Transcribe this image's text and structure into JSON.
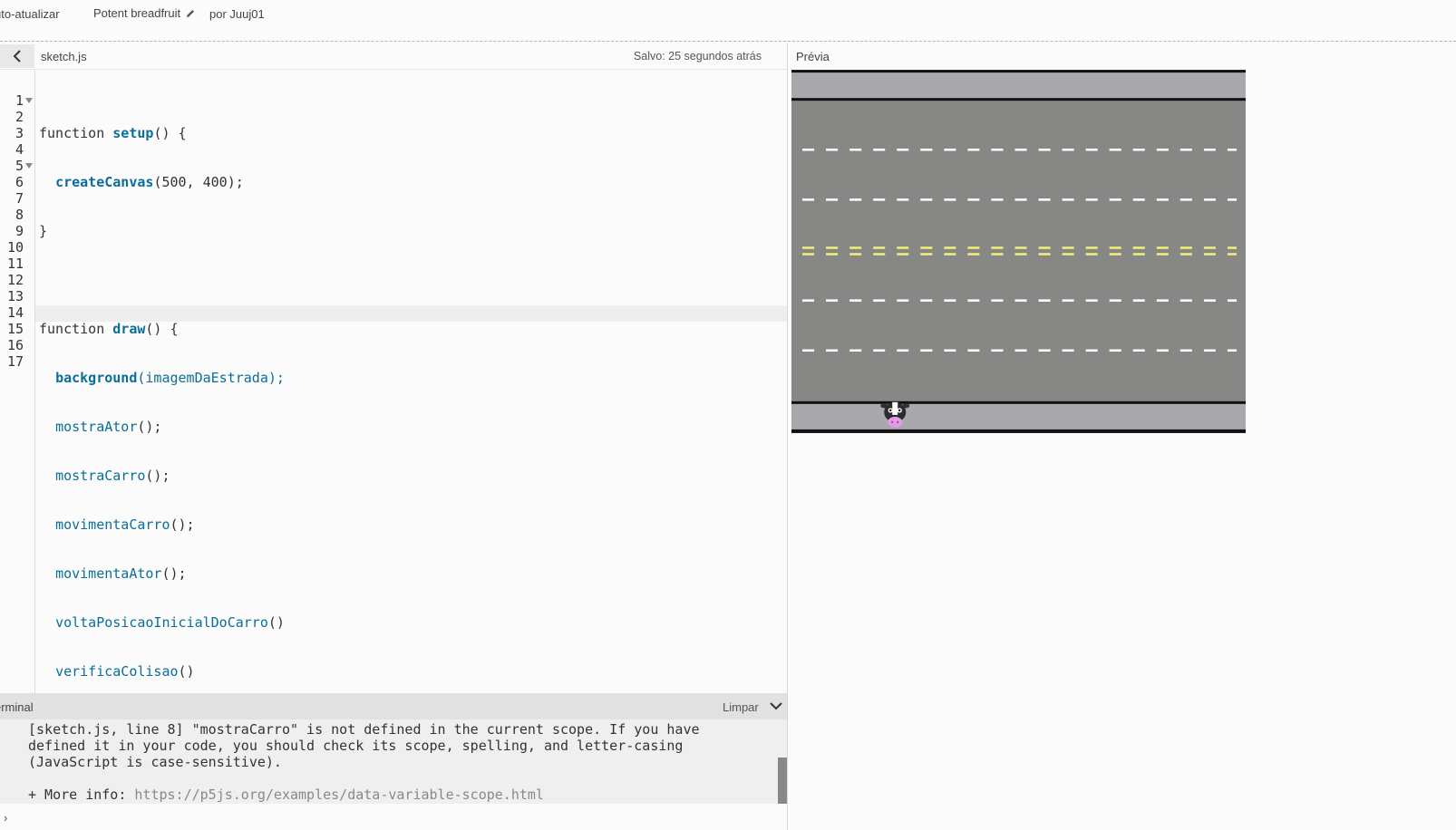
{
  "topbar": {
    "auto_refresh": "uto-atualizar",
    "project_name": "Potent breadfruit",
    "author": "por Juuj01"
  },
  "editor": {
    "filename": "sketch.js",
    "saved_status": "Salvo: 25 segundos atrás",
    "line_numbers": [
      "1",
      "2",
      "3",
      "4",
      "5",
      "6",
      "7",
      "8",
      "9",
      "10",
      "11",
      "12",
      "13",
      "14",
      "15",
      "16",
      "17"
    ],
    "code": {
      "l1_kw": "function ",
      "l1_fn": "setup",
      "l1_rest": "() {",
      "l2_fn": "createCanvas",
      "l2_rest": "(500, 400);",
      "l3": "}",
      "l5_kw": "function ",
      "l5_fn": "draw",
      "l5_rest": "() {",
      "l6_fn": "background",
      "l6_arg": "(imagemDaEstrada);",
      "l7": "mostraAtor",
      "l8": "mostraCarro",
      "l9": "movimentaCarro",
      "l10": "movimentaAtor",
      "l11": "voltaPosicaoInicialDoCarro",
      "l12": "verificaColisao",
      "semi_call": "();",
      "plain_call": "()",
      "l13": "}"
    }
  },
  "console": {
    "title": "erminal",
    "clear_label": "Limpar",
    "error_text": "[sketch.js, line 8] \"mostraCarro\" is not defined in the current scope. If you have defined it in your code, you should check its scope, spelling, and letter-casing (JavaScript is case-sensitive).",
    "more_info_label": "+ More info: ",
    "more_info_url": "https://p5js.org/examples/data-variable-scope.html",
    "prompt": "›"
  },
  "preview": {
    "label": "Prévia"
  },
  "colors": {
    "road": "#878886",
    "sidewalk": "#a9a8ad",
    "white_lane": "#ffffff",
    "yellow_lane": "#f2f07a",
    "link_blue": "#0b6e99"
  },
  "icons": {
    "collapse": "chevron-left-icon",
    "edit": "pencil-icon",
    "console_toggle": "chevron-down-icon",
    "actor": "cow-icon"
  }
}
